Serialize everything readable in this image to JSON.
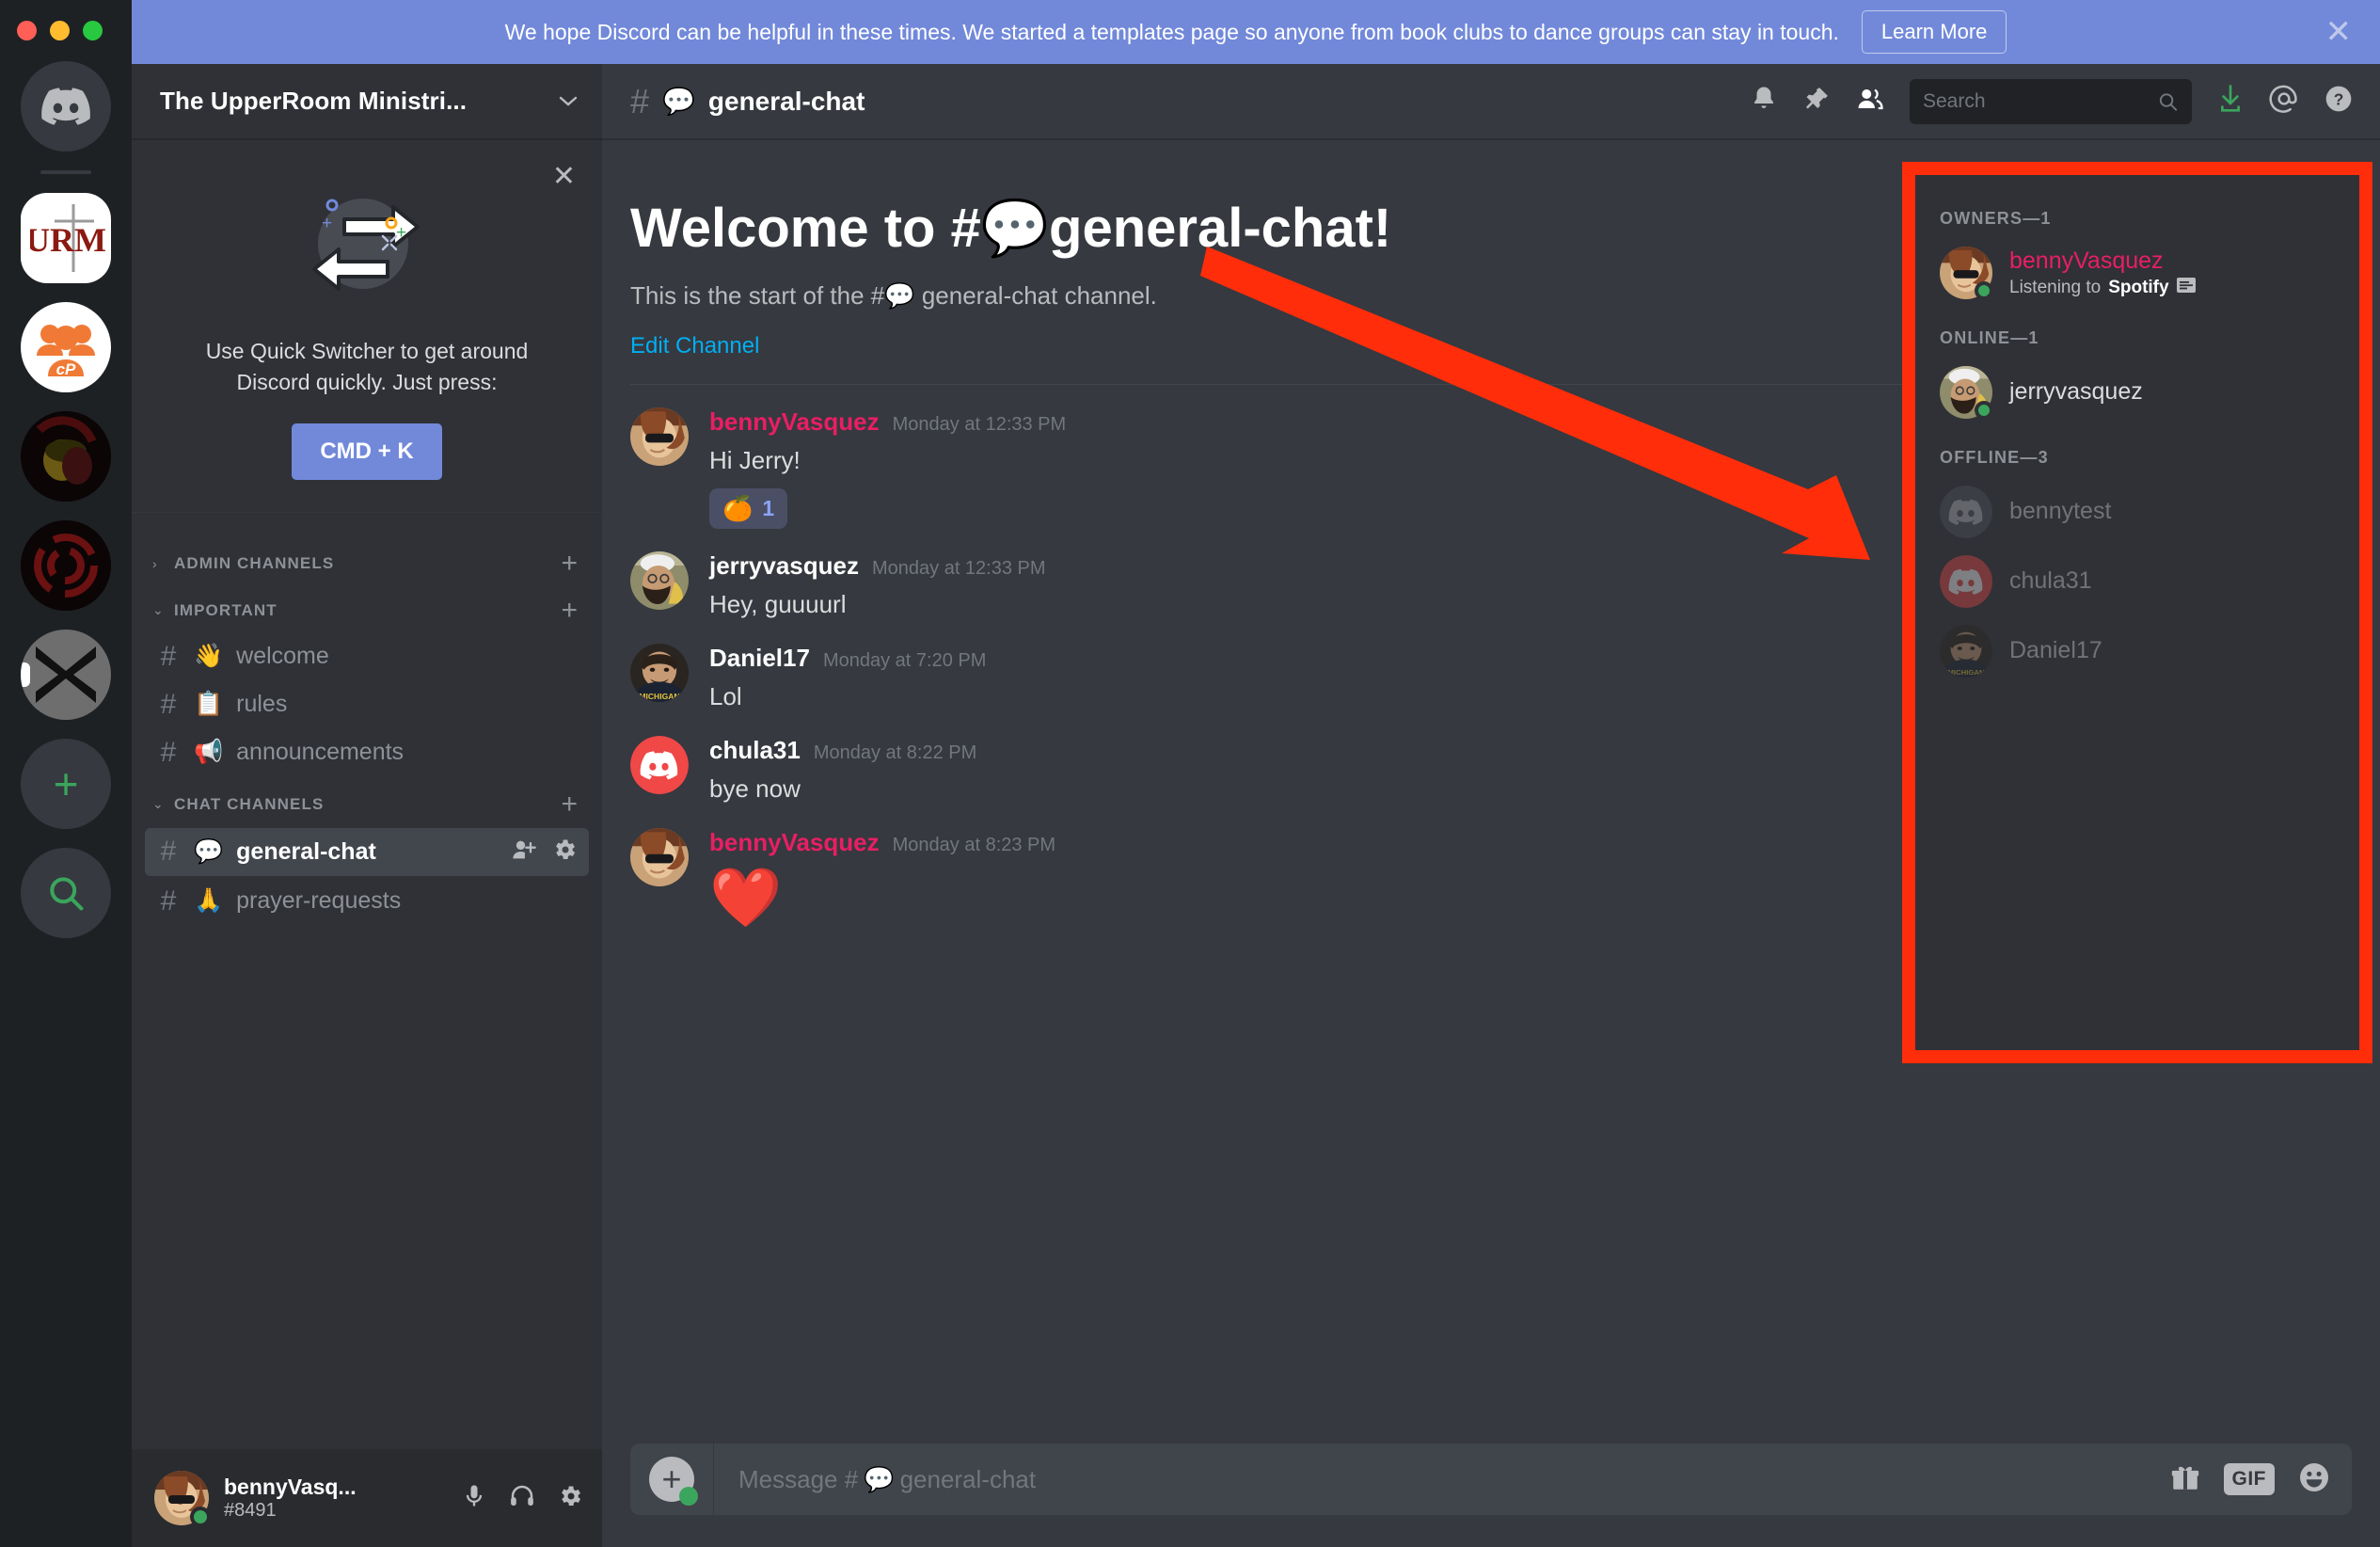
{
  "banner": {
    "text": "We hope Discord can be helpful in these times. We started a templates page so anyone from book clubs to dance groups can stay in touch.",
    "button": "Learn More",
    "close": "✕",
    "bg_color": "#7289da"
  },
  "window_controls": {
    "close": "close",
    "minimize": "minimize",
    "zoom": "zoom"
  },
  "server_rail": {
    "items": [
      {
        "name": "discord-home",
        "label": "",
        "kind": "discord-logo"
      },
      {
        "name": "upperroom-ministries",
        "label": "URM",
        "kind": "urm",
        "selected": true
      },
      {
        "name": "church-people",
        "label": "cP",
        "kind": "cp"
      },
      {
        "name": "server-dark-portrait",
        "label": "",
        "kind": "dark"
      },
      {
        "name": "server-dark-ring",
        "label": "",
        "kind": "dark"
      },
      {
        "name": "server-x",
        "label": "X",
        "kind": "x"
      }
    ],
    "add_server": "+",
    "explore_servers": "⌕"
  },
  "sidebar": {
    "guild_name": "The UpperRoom Ministri...",
    "guild_chevron": "⌄",
    "quick_switcher": {
      "close": "✕",
      "text": "Use Quick Switcher to get around Discord quickly. Just press:",
      "button": "CMD + K"
    },
    "categories": [
      {
        "name": "ADMIN CHANNELS",
        "collapsed": true,
        "arrow": "›",
        "plus": "+",
        "channels": []
      },
      {
        "name": "IMPORTANT",
        "collapsed": false,
        "arrow": "⌄",
        "plus": "+",
        "channels": [
          {
            "emoji": "👋",
            "label": "welcome",
            "active": false
          },
          {
            "emoji": "📋",
            "label": "rules",
            "active": false
          },
          {
            "emoji": "📢",
            "label": "announcements",
            "active": false
          }
        ]
      },
      {
        "name": "CHAT CHANNELS",
        "collapsed": false,
        "arrow": "⌄",
        "plus": "+",
        "channels": [
          {
            "emoji": "💬",
            "label": "general-chat",
            "active": true
          },
          {
            "emoji": "🙏",
            "label": "prayer-requests",
            "active": false
          }
        ]
      }
    ],
    "user_panel": {
      "name": "bennyVasq...",
      "tag": "#8491",
      "status": "online",
      "mute_icon": "microphone-icon",
      "deafen_icon": "headphones-icon",
      "settings_icon": "gear-icon"
    }
  },
  "channel_header": {
    "hash": "#",
    "emoji": "💬",
    "name": "general-chat",
    "icons": [
      "notification-bell-icon",
      "pin-icon",
      "members-icon",
      "inbox-icon",
      "mentions-icon",
      "help-icon"
    ]
  },
  "search": {
    "placeholder": "Search",
    "value": ""
  },
  "welcome": {
    "title_prefix": "Welcome to #",
    "title_emoji": "💬",
    "title_suffix": "general-chat!",
    "subtitle_prefix": "This is the start of the #",
    "subtitle_emoji": "💬",
    "subtitle_suffix": " general-chat channel.",
    "edit_link": "Edit Channel"
  },
  "messages": [
    {
      "author": "bennyVasquez",
      "is_owner": true,
      "timestamp": "Monday at 12:33 PM",
      "text": "Hi Jerry!",
      "big_emoji": false,
      "reactions": [
        {
          "emoji": "🍊",
          "count": "1"
        }
      ]
    },
    {
      "author": "jerryvasquez",
      "is_owner": false,
      "timestamp": "Monday at 12:33 PM",
      "text": "Hey, guuuurl",
      "big_emoji": false,
      "reactions": []
    },
    {
      "author": "Daniel17",
      "is_owner": false,
      "timestamp": "Monday at 7:20 PM",
      "text": "Lol",
      "big_emoji": false,
      "reactions": []
    },
    {
      "author": "chula31",
      "is_owner": false,
      "timestamp": "Monday at 8:22 PM",
      "text": "bye now",
      "big_emoji": false,
      "reactions": []
    },
    {
      "author": "bennyVasquez",
      "is_owner": true,
      "timestamp": "Monday at 8:23 PM",
      "text": "❤️",
      "big_emoji": true,
      "reactions": []
    }
  ],
  "composer": {
    "placeholder_prefix": "Message #",
    "placeholder_emoji": "💬",
    "placeholder_suffix": " general-chat",
    "value": "",
    "gift_icon": "gift-icon",
    "gif_label": "GIF",
    "emoji_icon": "emoji-icon",
    "upload_label": "+"
  },
  "members": {
    "groups": [
      {
        "title": "OWNERS—1",
        "people": [
          {
            "name": "bennyVasquez",
            "is_owner": true,
            "status": "online",
            "activity_prefix": "Listening to ",
            "activity_app": "Spotify",
            "activity_icon": "spotify-list-icon",
            "offline": false,
            "avatar": "benny"
          }
        ]
      },
      {
        "title": "ONLINE—1",
        "people": [
          {
            "name": "jerryvasquez",
            "is_owner": false,
            "status": "online",
            "activity_prefix": "",
            "activity_app": "",
            "offline": false,
            "avatar": "jerry"
          }
        ]
      },
      {
        "title": "OFFLINE—3",
        "people": [
          {
            "name": "bennytest",
            "is_owner": false,
            "status": "offline",
            "offline": true,
            "avatar": "grey-discord"
          },
          {
            "name": "chula31",
            "is_owner": false,
            "status": "offline",
            "offline": true,
            "avatar": "red-discord"
          },
          {
            "name": "Daniel17",
            "is_owner": false,
            "status": "offline",
            "offline": true,
            "avatar": "daniel"
          }
        ]
      }
    ]
  },
  "annotations": {
    "arrow_color": "#ff2d0a",
    "highlight_color": "#ff2d0a",
    "arrow_description": "red arrow pointing to member list",
    "highlight_description": "red rectangle around member list panel"
  }
}
